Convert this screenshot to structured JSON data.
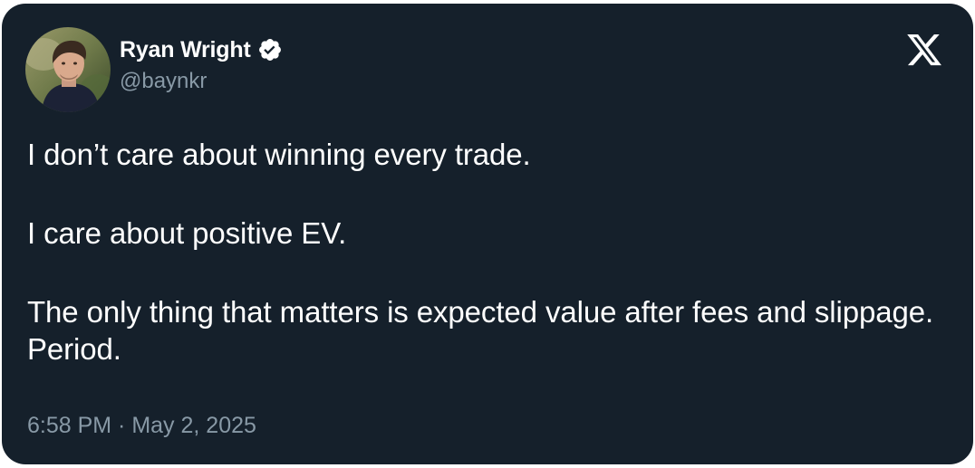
{
  "author": {
    "display_name": "Ryan Wright",
    "handle": "@baynkr",
    "verified": true
  },
  "tweet": {
    "paragraphs": [
      "I don’t care about winning every trade.",
      "I care about positive EV.",
      "The only thing that matters is expected value after fees and slippage. Period."
    ],
    "timestamp": "6:58 PM · May 2, 2025"
  },
  "icons": {
    "verified": "verified-badge-icon",
    "platform": "x-logo-icon"
  },
  "colors": {
    "card_background": "#15202b",
    "primary_text": "#ffffff",
    "secondary_text": "#8899a6"
  }
}
